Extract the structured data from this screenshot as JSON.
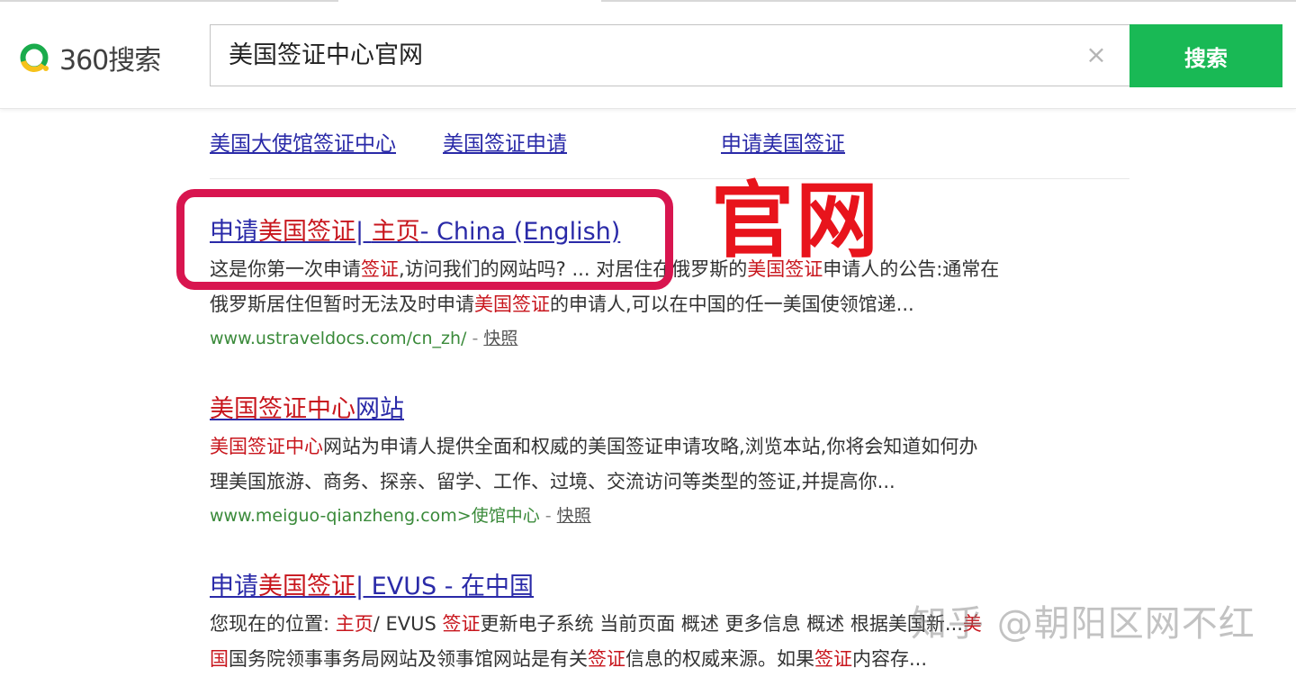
{
  "header": {
    "logo_text": "360搜索",
    "search_query": "美国签证中心官网",
    "search_button": "搜索",
    "clear_icon": "×"
  },
  "related": [
    "美国大使馆签证中心",
    "美国签证申请",
    "申请美国签证"
  ],
  "annotation": {
    "label": "官网"
  },
  "results": [
    {
      "title": [
        {
          "t": "申请",
          "hl": false
        },
        {
          "t": "美国签证",
          "hl": true
        },
        {
          "t": "| ",
          "hl": false
        },
        {
          "t": "主页",
          "hl": true
        },
        {
          "t": "- China (English)",
          "hl": false
        }
      ],
      "desc1": [
        {
          "t": "这是你第一次申请",
          "hl": false
        },
        {
          "t": "签证",
          "hl": true
        },
        {
          "t": ",访问我们的网站吗? ... 对居住在俄罗斯的",
          "hl": false
        },
        {
          "t": "美国签证",
          "hl": true
        },
        {
          "t": "申请人的公告:通常在",
          "hl": false
        }
      ],
      "desc2": [
        {
          "t": "俄罗斯居住但暂时无法及时申请",
          "hl": false
        },
        {
          "t": "美国签证",
          "hl": true
        },
        {
          "t": "的申请人,可以在中国的任一美国使领馆递...",
          "hl": false
        }
      ],
      "url": "www.ustraveldocs.com/cn_zh/",
      "sep": " - ",
      "snapshot": "快照"
    },
    {
      "title": [
        {
          "t": "美国签证中心",
          "hl": true
        },
        {
          "t": "网站",
          "hl": false
        }
      ],
      "desc1": [
        {
          "t": "美国签证中心",
          "hl": true
        },
        {
          "t": "网站为申请人提供全面和权威的美国签证申请攻略,浏览本站,你将会知道如何办",
          "hl": false
        }
      ],
      "desc2": [
        {
          "t": "理美国旅游、商务、探亲、留学、工作、过境、交流访问等类型的签证,并提高你...",
          "hl": false
        }
      ],
      "url": "www.meiguo-qianzheng.com>使馆中心",
      "sep": " - ",
      "snapshot": "快照"
    },
    {
      "title": [
        {
          "t": "申请",
          "hl": false
        },
        {
          "t": "美国签证",
          "hl": true
        },
        {
          "t": "| EVUS - 在中国",
          "hl": false
        }
      ],
      "desc1": [
        {
          "t": "您现在的位置: ",
          "hl": false
        },
        {
          "t": "主页",
          "hl": true
        },
        {
          "t": "/ EVUS ",
          "hl": false
        },
        {
          "t": "签证",
          "hl": true
        },
        {
          "t": "更新电子系统 当前页面 概述 更多信息 概述 根据美国新...",
          "hl": false
        },
        {
          "t": "美",
          "hl": true
        }
      ],
      "desc2": [
        {
          "t": "国",
          "hl": true
        },
        {
          "t": "国务院领事事务局网站及领事馆网站是有关",
          "hl": false
        },
        {
          "t": "签证",
          "hl": true
        },
        {
          "t": "信息的权威来源。如果",
          "hl": false
        },
        {
          "t": "签证",
          "hl": true
        },
        {
          "t": "内容存...",
          "hl": false
        }
      ]
    }
  ],
  "watermark": "知乎 @朝阳区网不红",
  "colors": {
    "brand_green": "#19b955",
    "link_blue": "#2a2aa8",
    "highlight_red": "#c8161d",
    "url_green": "#3a8a3a",
    "annotation_pink": "#d8154f",
    "annotation_red": "#e8141c"
  }
}
